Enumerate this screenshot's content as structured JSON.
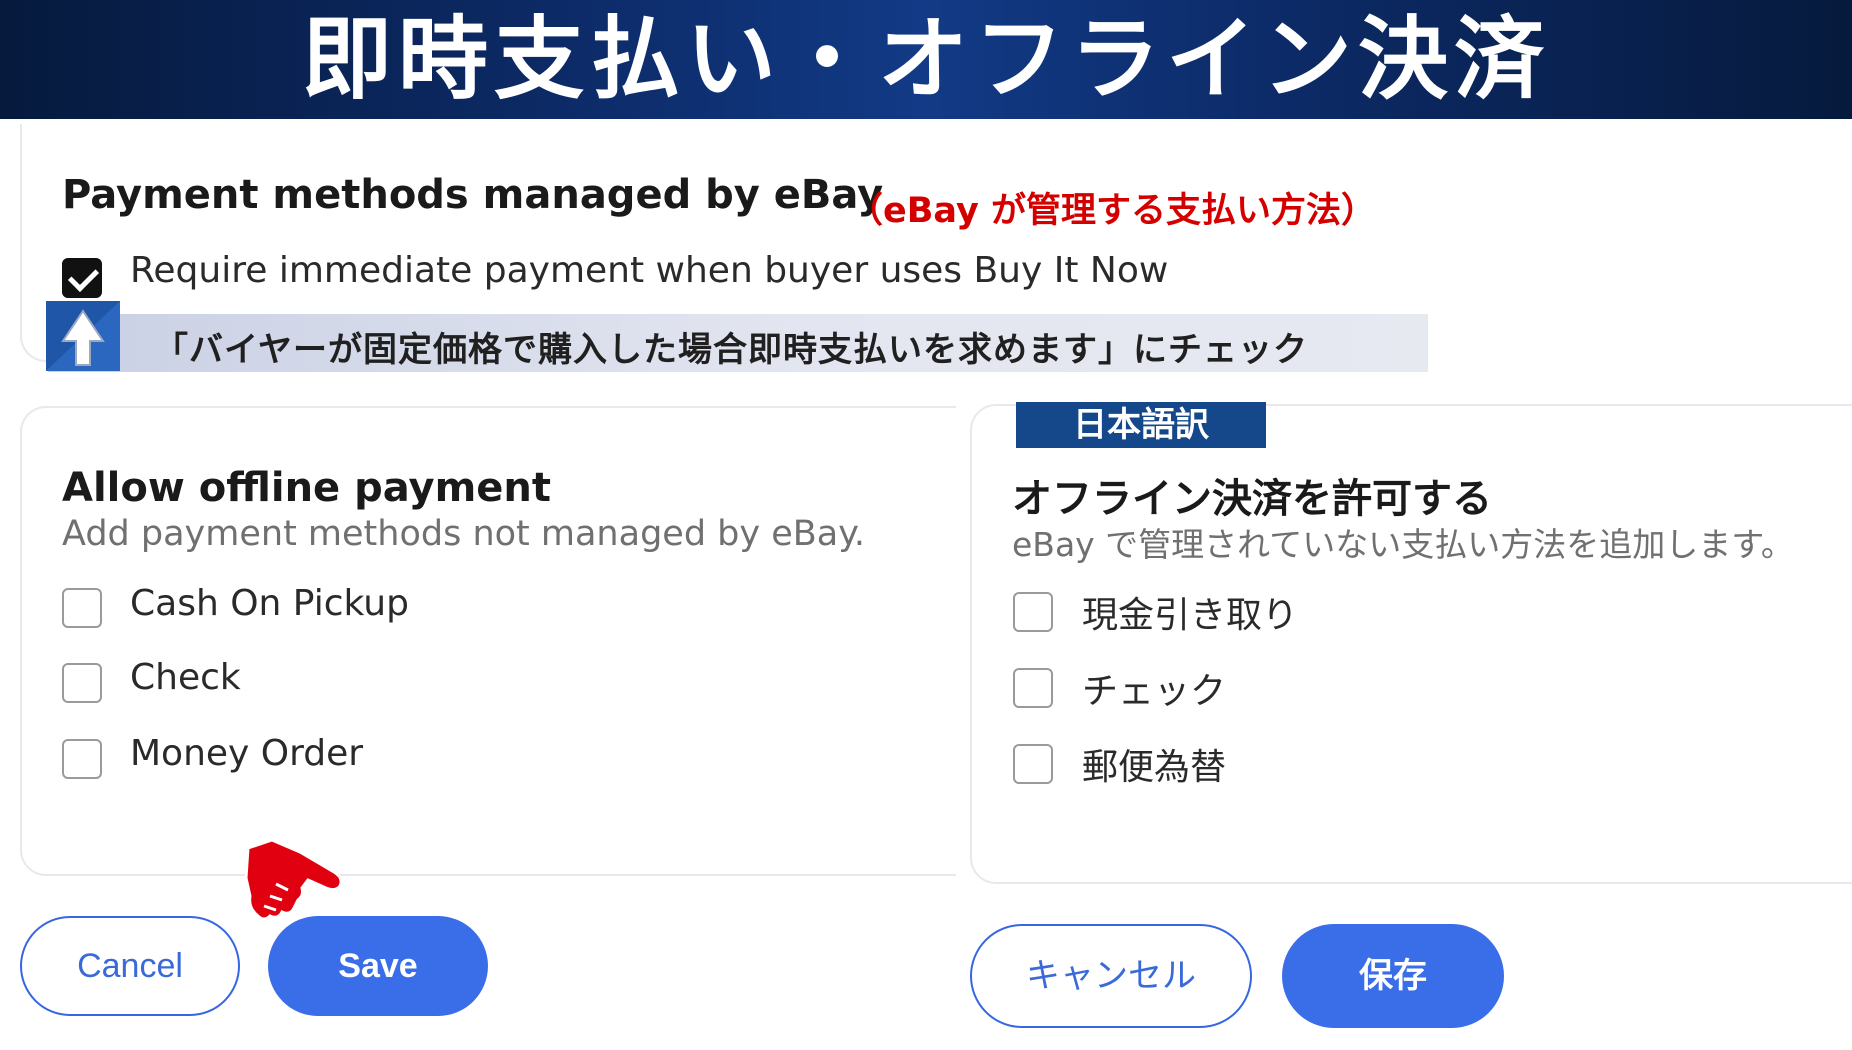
{
  "banner": {
    "title": "即時支払い・オフライン決済"
  },
  "managed_section": {
    "title": "Payment methods managed by eBay",
    "note_jp": "（eBay が管理する支払い方法）",
    "checkbox_label": "Require immediate payment when buyer uses Buy It Now",
    "checkbox_checked": true
  },
  "callout": {
    "text": "「バイヤーが固定価格で購入した場合即時支払いを求めます」にチェック",
    "icon": "up-arrow-icon"
  },
  "offline_en": {
    "title": "Allow offline payment",
    "subtitle": "Add payment methods not managed by eBay.",
    "options": [
      {
        "label": "Cash On Pickup",
        "checked": false
      },
      {
        "label": "Check",
        "checked": false
      },
      {
        "label": "Money Order",
        "checked": false
      }
    ],
    "cancel_label": "Cancel",
    "save_label": "Save"
  },
  "offline_jp": {
    "tag": "日本語訳",
    "title": "オフライン決済を許可する",
    "subtitle": "eBay で管理されていない支払い方法を追加します。",
    "options": [
      {
        "label": "現金引き取り",
        "checked": false
      },
      {
        "label": "チェック",
        "checked": false
      },
      {
        "label": "郵便為替",
        "checked": false
      }
    ],
    "cancel_label": "キャンセル",
    "save_label": "保存"
  },
  "pointer": {
    "icon": "pointing-hand-icon"
  },
  "colors": {
    "banner_bg": "#0c2a66",
    "accent_blue": "#3a6ee8",
    "note_red": "#d40000",
    "tag_blue": "#14488a"
  }
}
